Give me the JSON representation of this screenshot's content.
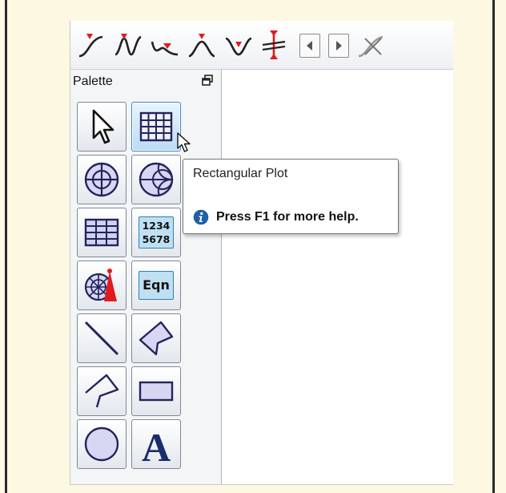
{
  "palette": {
    "title": "Palette",
    "tools": [
      {
        "id": "select",
        "icon": "pointer-arrow-icon"
      },
      {
        "id": "rectangular-plot",
        "icon": "grid-plot-icon"
      },
      {
        "id": "polar-plot",
        "icon": "polar-plot-icon"
      },
      {
        "id": "smith-chart",
        "icon": "smith-chart-icon"
      },
      {
        "id": "list-display",
        "icon": "table-grid-icon"
      },
      {
        "id": "tabular-display",
        "icon": "number-table-icon",
        "lines": [
          "1234",
          "5678"
        ]
      },
      {
        "id": "antenna-plot",
        "icon": "antenna-plot-icon"
      },
      {
        "id": "equation",
        "icon": "equation-icon",
        "label": "Eqn"
      },
      {
        "id": "line",
        "icon": "line-icon"
      },
      {
        "id": "polygon",
        "icon": "polygon-icon"
      },
      {
        "id": "polyline",
        "icon": "polyline-icon"
      },
      {
        "id": "rectangle",
        "icon": "rectangle-icon"
      },
      {
        "id": "ellipse",
        "icon": "ellipse-icon"
      },
      {
        "id": "text",
        "icon": "text-icon",
        "label": "A"
      }
    ],
    "active_tool": "rectangular-plot"
  },
  "toolbar": {
    "icons": [
      "marker-curve-icon",
      "marker-wave-icon",
      "marker-delta-icon",
      "marker-peak-icon",
      "marker-valley-icon",
      "marker-line-icon",
      "arrow-left-icon",
      "arrow-right-icon",
      "marker-clear-icon"
    ]
  },
  "tooltip": {
    "title": "Rectangular Plot",
    "help": "Press F1 for more help."
  },
  "colors": {
    "background": "#fdf8e2",
    "accent": "#3c86c6",
    "marker_red": "#e21b1b",
    "info_blue": "#1f5fa8"
  }
}
